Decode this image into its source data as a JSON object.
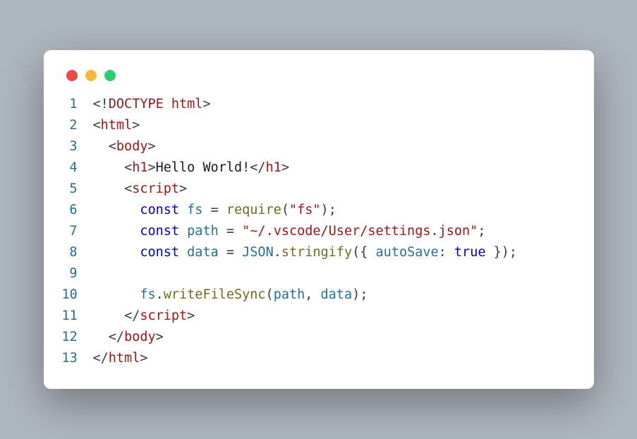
{
  "traffic_lights": [
    "red",
    "yellow",
    "green"
  ],
  "code": {
    "lines": [
      {
        "no": "1",
        "tokens": [
          {
            "t": "<!",
            "cls": "c-punc"
          },
          {
            "t": "DOCTYPE ",
            "cls": "c-tag"
          },
          {
            "t": "html",
            "cls": "c-tag"
          },
          {
            "t": ">",
            "cls": "c-punc"
          }
        ]
      },
      {
        "no": "2",
        "tokens": [
          {
            "t": "<",
            "cls": "c-punc"
          },
          {
            "t": "html",
            "cls": "c-tag"
          },
          {
            "t": ">",
            "cls": "c-punc"
          }
        ]
      },
      {
        "no": "3",
        "tokens": [
          {
            "t": "  ",
            "cls": "c-text"
          },
          {
            "t": "<",
            "cls": "c-punc"
          },
          {
            "t": "body",
            "cls": "c-tag"
          },
          {
            "t": ">",
            "cls": "c-punc"
          }
        ]
      },
      {
        "no": "4",
        "tokens": [
          {
            "t": "    ",
            "cls": "c-text"
          },
          {
            "t": "<",
            "cls": "c-punc"
          },
          {
            "t": "h1",
            "cls": "c-tag"
          },
          {
            "t": ">",
            "cls": "c-punc"
          },
          {
            "t": "Hello World!",
            "cls": "c-text"
          },
          {
            "t": "</",
            "cls": "c-punc"
          },
          {
            "t": "h1",
            "cls": "c-tag"
          },
          {
            "t": ">",
            "cls": "c-punc"
          }
        ]
      },
      {
        "no": "5",
        "tokens": [
          {
            "t": "    ",
            "cls": "c-text"
          },
          {
            "t": "<",
            "cls": "c-punc"
          },
          {
            "t": "script",
            "cls": "c-tag"
          },
          {
            "t": ">",
            "cls": "c-punc"
          }
        ]
      },
      {
        "no": "6",
        "tokens": [
          {
            "t": "      ",
            "cls": "c-text"
          },
          {
            "t": "const",
            "cls": "c-kw"
          },
          {
            "t": " ",
            "cls": "c-text"
          },
          {
            "t": "fs",
            "cls": "c-var"
          },
          {
            "t": " ",
            "cls": "c-text"
          },
          {
            "t": "=",
            "cls": "c-punc"
          },
          {
            "t": " ",
            "cls": "c-text"
          },
          {
            "t": "require",
            "cls": "c-fn"
          },
          {
            "t": "(",
            "cls": "c-punc"
          },
          {
            "t": "\"fs\"",
            "cls": "c-str"
          },
          {
            "t": ")",
            "cls": "c-punc"
          },
          {
            "t": ";",
            "cls": "c-punc"
          }
        ]
      },
      {
        "no": "7",
        "tokens": [
          {
            "t": "      ",
            "cls": "c-text"
          },
          {
            "t": "const",
            "cls": "c-kw"
          },
          {
            "t": " ",
            "cls": "c-text"
          },
          {
            "t": "path",
            "cls": "c-var"
          },
          {
            "t": " ",
            "cls": "c-text"
          },
          {
            "t": "=",
            "cls": "c-punc"
          },
          {
            "t": " ",
            "cls": "c-text"
          },
          {
            "t": "\"~/.vscode/User/settings.json\"",
            "cls": "c-str"
          },
          {
            "t": ";",
            "cls": "c-punc"
          }
        ]
      },
      {
        "no": "8",
        "tokens": [
          {
            "t": "      ",
            "cls": "c-text"
          },
          {
            "t": "const",
            "cls": "c-kw"
          },
          {
            "t": " ",
            "cls": "c-text"
          },
          {
            "t": "data",
            "cls": "c-var"
          },
          {
            "t": " ",
            "cls": "c-text"
          },
          {
            "t": "=",
            "cls": "c-punc"
          },
          {
            "t": " ",
            "cls": "c-text"
          },
          {
            "t": "JSON",
            "cls": "c-obj"
          },
          {
            "t": ".",
            "cls": "c-punc"
          },
          {
            "t": "stringify",
            "cls": "c-fn"
          },
          {
            "t": "(",
            "cls": "c-punc"
          },
          {
            "t": "{ ",
            "cls": "c-punc"
          },
          {
            "t": "autoSave",
            "cls": "c-prop"
          },
          {
            "t": ":",
            "cls": "c-punc"
          },
          {
            "t": " ",
            "cls": "c-text"
          },
          {
            "t": "true",
            "cls": "c-bool"
          },
          {
            "t": " }",
            "cls": "c-punc"
          },
          {
            "t": ")",
            "cls": "c-punc"
          },
          {
            "t": ";",
            "cls": "c-punc"
          }
        ]
      },
      {
        "no": "9",
        "tokens": []
      },
      {
        "no": "10",
        "tokens": [
          {
            "t": "      ",
            "cls": "c-text"
          },
          {
            "t": "fs",
            "cls": "c-var"
          },
          {
            "t": ".",
            "cls": "c-punc"
          },
          {
            "t": "writeFileSync",
            "cls": "c-fn"
          },
          {
            "t": "(",
            "cls": "c-punc"
          },
          {
            "t": "path",
            "cls": "c-var"
          },
          {
            "t": ",",
            "cls": "c-punc"
          },
          {
            "t": " ",
            "cls": "c-text"
          },
          {
            "t": "data",
            "cls": "c-var"
          },
          {
            "t": ")",
            "cls": "c-punc"
          },
          {
            "t": ";",
            "cls": "c-punc"
          }
        ]
      },
      {
        "no": "11",
        "tokens": [
          {
            "t": "    ",
            "cls": "c-text"
          },
          {
            "t": "</",
            "cls": "c-punc"
          },
          {
            "t": "script",
            "cls": "c-tag"
          },
          {
            "t": ">",
            "cls": "c-punc"
          }
        ]
      },
      {
        "no": "12",
        "tokens": [
          {
            "t": "  ",
            "cls": "c-text"
          },
          {
            "t": "</",
            "cls": "c-punc"
          },
          {
            "t": "body",
            "cls": "c-tag"
          },
          {
            "t": ">",
            "cls": "c-punc"
          }
        ]
      },
      {
        "no": "13",
        "tokens": [
          {
            "t": "</",
            "cls": "c-punc"
          },
          {
            "t": "html",
            "cls": "c-tag"
          },
          {
            "t": ">",
            "cls": "c-punc"
          }
        ]
      }
    ]
  }
}
